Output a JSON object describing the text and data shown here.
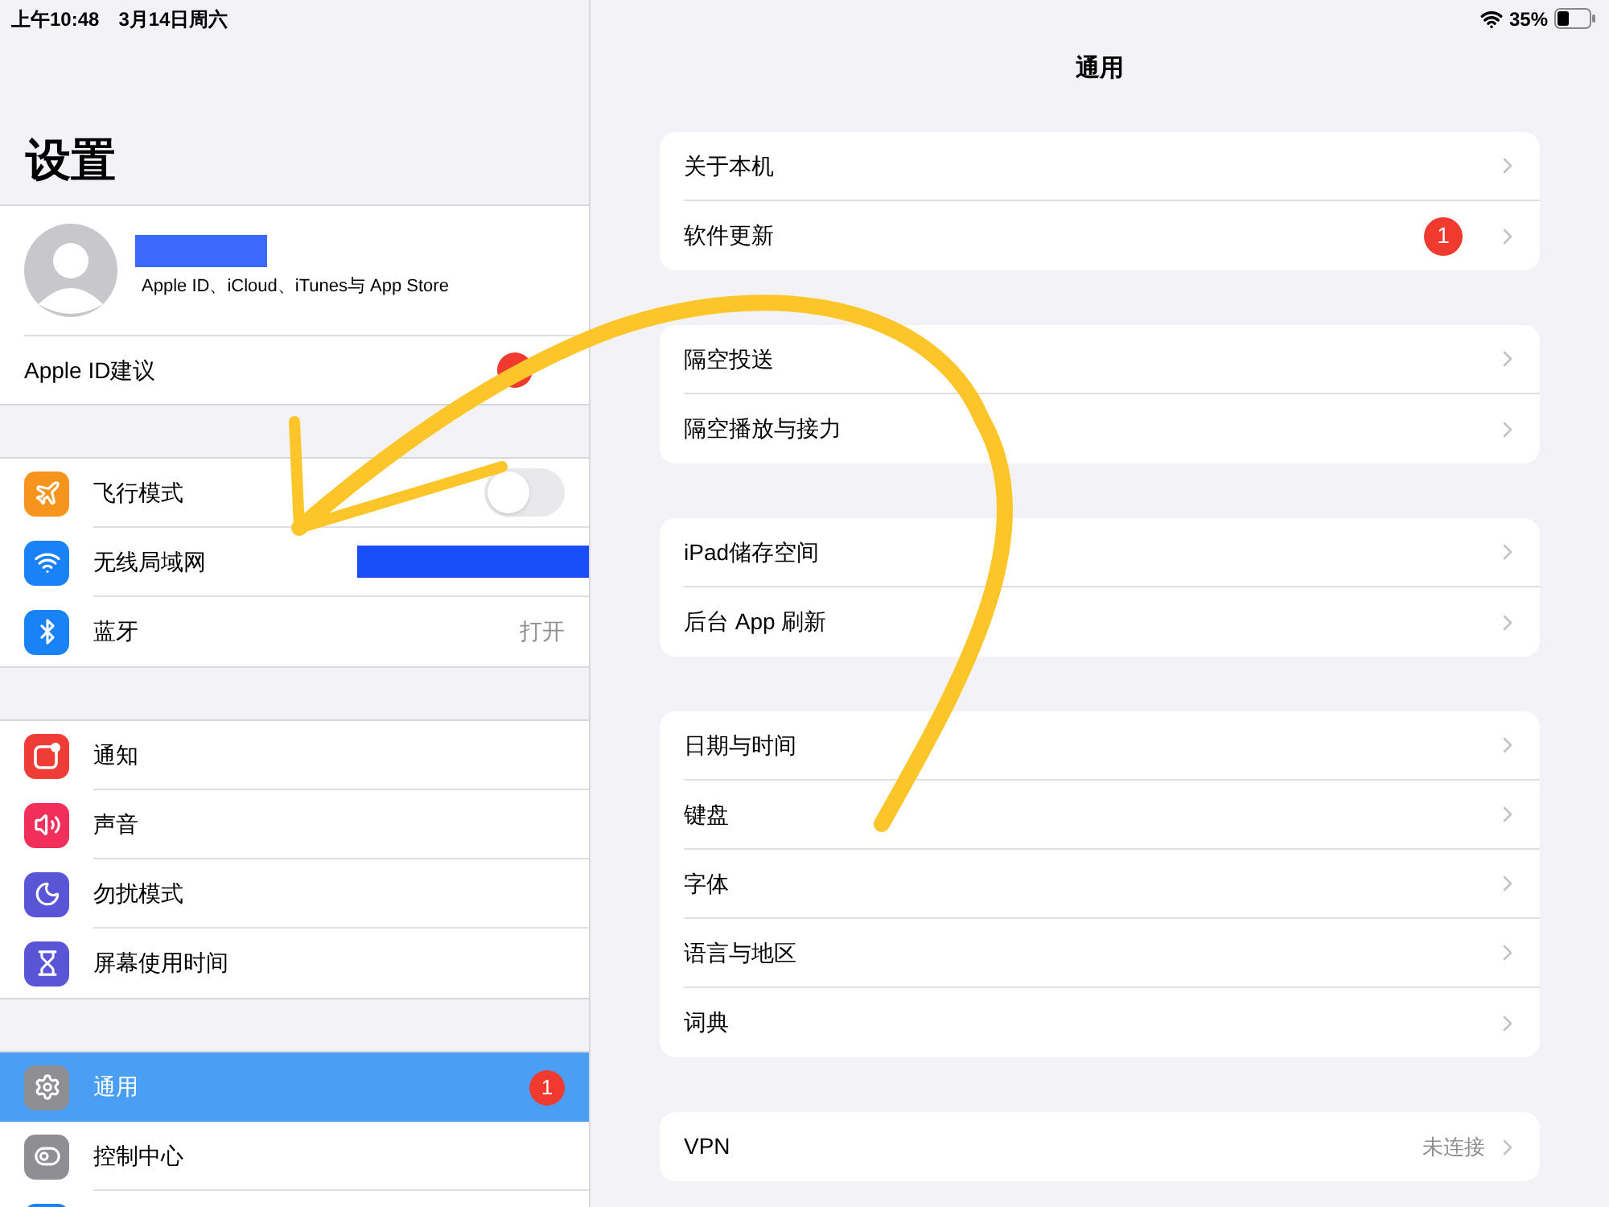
{
  "status_bar": {
    "time": "上午10:48",
    "date": "3月14日周六",
    "battery": "35%"
  },
  "sidebar": {
    "title": "设置",
    "profile": {
      "subtitle": "Apple ID、iCloud、iTunes与 App Store"
    },
    "suggestion": {
      "label": "Apple ID建议",
      "badge": true
    },
    "groups": [
      [
        {
          "kind": "toggle",
          "label": "飞行模式",
          "color": "#f7941d",
          "on": false,
          "selected": false
        },
        {
          "kind": "link",
          "label": "无线局域网",
          "color": "#1a82f7",
          "redacted": true,
          "selected": false
        },
        {
          "kind": "link",
          "label": "蓝牙",
          "color": "#1a82f7",
          "value": "打开",
          "selected": false
        }
      ],
      [
        {
          "kind": "link",
          "label": "通知",
          "color": "#f03c36",
          "selected": false
        },
        {
          "kind": "link",
          "label": "声音",
          "color": "#f22e5a",
          "selected": false
        },
        {
          "kind": "link",
          "label": "勿扰模式",
          "color": "#5a55d6",
          "selected": false
        },
        {
          "kind": "link",
          "label": "屏幕使用时间",
          "color": "#5a55d6",
          "selected": false
        }
      ],
      [
        {
          "kind": "link",
          "label": "通用",
          "color": "#8e8e93",
          "badge": "1",
          "selected": true
        },
        {
          "kind": "link",
          "label": "控制中心",
          "color": "#8e8e93",
          "selected": false
        },
        {
          "kind": "link",
          "color": "#1a82f7",
          "selected": false
        }
      ]
    ]
  },
  "detail": {
    "title": "通用",
    "groups": [
      [
        {
          "label": "关于本机"
        },
        {
          "label": "软件更新",
          "badge": "1"
        }
      ],
      [
        {
          "label": "隔空投送"
        },
        {
          "label": "隔空播放与接力"
        }
      ],
      [
        {
          "label": "iPad储存空间"
        },
        {
          "label": "后台 App 刷新"
        }
      ],
      [
        {
          "label": "日期与时间"
        },
        {
          "label": "键盘"
        },
        {
          "label": "字体"
        },
        {
          "label": "语言与地区"
        },
        {
          "label": "词典"
        }
      ],
      [
        {
          "label": "VPN",
          "value": "未连接"
        }
      ]
    ]
  }
}
